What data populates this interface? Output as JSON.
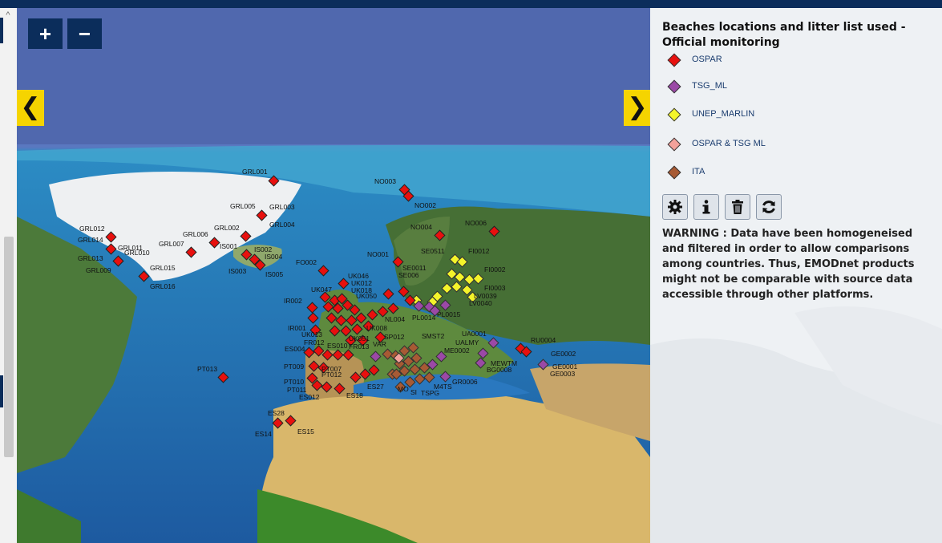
{
  "map": {
    "zoom_in_label": "+",
    "zoom_out_label": "−",
    "prev_label": "❮",
    "next_label": "❯",
    "beach_labels": [
      "GRL001",
      "GRL003",
      "GRL005",
      "GRL004",
      "GRL002",
      "GRL006",
      "GRL007",
      "GRL012",
      "GRL014",
      "GRL011",
      "GRL010",
      "GRL013",
      "GRL009",
      "GRL015",
      "GRL016",
      "IS001",
      "IS002",
      "IS004",
      "IS003",
      "IS005",
      "FO002",
      "NO003",
      "NO002",
      "NO004",
      "NO006",
      "NO001",
      "SE0511",
      "SE0011",
      "SE006",
      "FI0012",
      "FI0002",
      "FI0003",
      "LV0039",
      "LV0040",
      "UK046",
      "UK012",
      "UK018",
      "UK047",
      "UK050",
      "IR002",
      "IR001",
      "UK013",
      "FR012",
      "UK051",
      "UK008",
      "NL004",
      "PL0014",
      "PL0015",
      "ES004",
      "ES010",
      "FR013",
      "VAR",
      "SP012",
      "SMST2",
      "UA0001",
      "UALMY",
      "ME0002",
      "RU0004",
      "GE0002",
      "GE0001",
      "GE0003",
      "MEWTM",
      "BG0008",
      "PT009",
      "PT007",
      "PT012",
      "PT010",
      "PT011",
      "ES012",
      "ES18",
      "ES27",
      "MO",
      "SI",
      "TSPG",
      "M4TS",
      "GR0006",
      "PT013",
      "ES28",
      "ES14",
      "ES15"
    ]
  },
  "panel": {
    "title": "Beaches locations and litter list used - Official monitoring",
    "legend": [
      {
        "label": "OSPAR",
        "color": "#e8100e"
      },
      {
        "label": "TSG_ML",
        "color": "#9b49a6"
      },
      {
        "label": "UNEP_MARLIN",
        "color": "#f4f42a"
      },
      {
        "label": "OSPAR & TSG ML",
        "color": "#f3a19a"
      },
      {
        "label": "ITA",
        "color": "#a75a34"
      }
    ],
    "tools": [
      {
        "name": "settings",
        "icon": "gear-icon"
      },
      {
        "name": "info",
        "icon": "info-icon"
      },
      {
        "name": "delete",
        "icon": "trash-icon"
      },
      {
        "name": "refresh",
        "icon": "refresh-icon"
      }
    ],
    "warning": "WARNING : Data have been homogeneised and filtered in order to allow comparisons among countries. Thus, EMODnet products might not be comparable with source data accessible through other platforms."
  }
}
